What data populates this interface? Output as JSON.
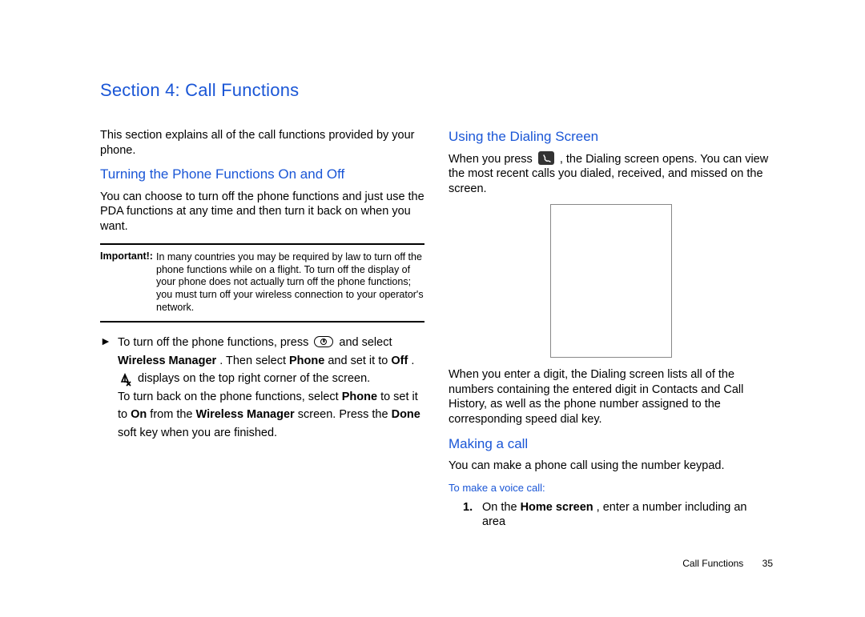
{
  "section_title": "Section 4: Call Functions",
  "intro": "This section explains all of the call functions provided by your phone.",
  "h_turning": "Turning the Phone Functions On and Off",
  "p_turning": "You can choose to turn off the phone functions and just use the PDA functions at any time and then turn it back on when you want.",
  "important_label": "Important!:",
  "important_body": "In many countries you may be required by law to turn off the phone functions while on a flight. To turn off the display of your phone does not actually turn off the phone functions; you must turn off your wireless connection to your operator's network.",
  "bullet_marker": "►",
  "b1_a": "To turn off the phone functions, press ",
  "b1_b": " and select ",
  "b1_c": "Wireless Manager",
  "b1_d": ". Then select ",
  "b1_e": "Phone",
  "b1_f": " and set it to ",
  "b1_g": "Off",
  "b1_h": ".",
  "b2": " displays on the top right corner of the screen.",
  "b3_a": "To turn back on the phone functions, select ",
  "b3_b": "Phone",
  "b3_c": " to set it to ",
  "b3_d": "On",
  "b3_e": " from the ",
  "b3_f": "Wireless Manager",
  "b3_g": " screen. Press the ",
  "b3_h": "Done",
  "b3_i": " soft key when you are finished.",
  "h_dialing": "Using the Dialing Screen",
  "d1_a": "When you press ",
  "d1_b": ", the Dialing screen opens. You can view the most recent calls you dialed, received, and missed on the screen.",
  "d2": "When you enter a digit, the Dialing screen lists all of the numbers containing the entered digit in Contacts and Call History, as well as the phone number assigned to the corresponding speed dial key.",
  "h_making": "Making a call",
  "m1": "You can make a phone call using the number keypad.",
  "h_voice": "To make a voice call:",
  "step_num": "1.",
  "step1_a": "On the ",
  "step1_b": "Home screen",
  "step1_c": ", enter a number including an area",
  "footer_label": "Call Functions",
  "footer_page": "35"
}
